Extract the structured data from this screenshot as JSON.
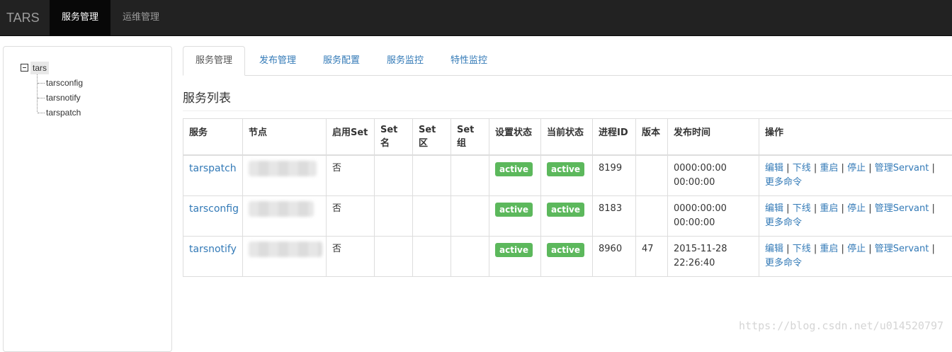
{
  "navbar": {
    "brand": "TARS",
    "items": [
      {
        "label": "服务管理",
        "active": true
      },
      {
        "label": "运维管理",
        "active": false
      }
    ]
  },
  "tree": {
    "root": "tars",
    "children": [
      "tarsconfig",
      "tarsnotify",
      "tarspatch"
    ]
  },
  "tabs": [
    {
      "label": "服务管理",
      "active": true
    },
    {
      "label": "发布管理"
    },
    {
      "label": "服务配置"
    },
    {
      "label": "服务监控"
    },
    {
      "label": "特性监控"
    }
  ],
  "section_title": "服务列表",
  "table": {
    "headers": [
      "服务",
      "节点",
      "启用Set",
      "Set名",
      "Set区",
      "Set组",
      "设置状态",
      "当前状态",
      "进程ID",
      "版本",
      "发布时间",
      "操作"
    ],
    "rows": [
      {
        "service": "tarspatch",
        "node": "",
        "set_enabled": "否",
        "set_name": "",
        "set_area": "",
        "set_group": "",
        "setting_state": "active",
        "present_state": "active",
        "pid": "8199",
        "version": "",
        "patch_time_1": "0000:00:00",
        "patch_time_2": "00:00:00"
      },
      {
        "service": "tarsconfig",
        "node": "",
        "set_enabled": "否",
        "set_name": "",
        "set_area": "",
        "set_group": "",
        "setting_state": "active",
        "present_state": "active",
        "pid": "8183",
        "version": "",
        "patch_time_1": "0000:00:00",
        "patch_time_2": "00:00:00"
      },
      {
        "service": "tarsnotify",
        "node": "",
        "set_enabled": "否",
        "set_name": "",
        "set_area": "",
        "set_group": "",
        "setting_state": "active",
        "present_state": "active",
        "pid": "8960",
        "version": "47",
        "patch_time_1": "2015-11-28",
        "patch_time_2": "22:26:40"
      }
    ],
    "ops": {
      "edit": "编辑",
      "offline": "下线",
      "restart": "重启",
      "stop": "停止",
      "manage_servant": "管理Servant",
      "more": "更多命令",
      "separator": "|"
    }
  },
  "watermark": "https://blog.csdn.net/u014520797",
  "colors": {
    "navbar_bg": "#222222",
    "link": "#337ab7",
    "label_success": "#5cb85c"
  }
}
